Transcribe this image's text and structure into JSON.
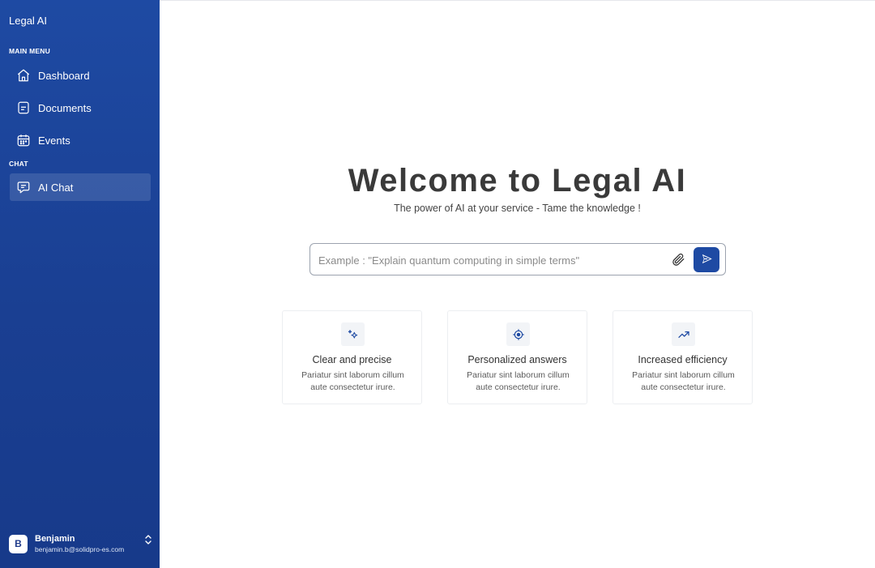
{
  "sidebar": {
    "brand": "Legal AI",
    "main_menu_label": "MAIN MENU",
    "main_menu_items": [
      {
        "label": "Dashboard",
        "icon": "home-icon"
      },
      {
        "label": "Documents",
        "icon": "document-icon"
      },
      {
        "label": "Events",
        "icon": "calendar-icon"
      }
    ],
    "chat_label": "CHAT",
    "chat_items": [
      {
        "label": "AI Chat",
        "icon": "chat-icon",
        "active": true
      }
    ],
    "user": {
      "initial": "B",
      "name": "Benjamin",
      "email": "benjamin.b@solidpro-es.com"
    }
  },
  "main": {
    "title": "Welcome to Legal AI",
    "subtitle": "The power of AI at your service - Tame the knowledge !",
    "search": {
      "placeholder": "Example : \"Explain quantum computing in simple terms\"",
      "value": ""
    },
    "cards": [
      {
        "icon": "sparkles-icon",
        "title": "Clear and precise",
        "desc": "Pariatur sint laborum cillum aute consectetur irure."
      },
      {
        "icon": "target-icon",
        "title": "Personalized answers",
        "desc": "Pariatur sint laborum cillum aute consectetur irure."
      },
      {
        "icon": "trending-up-icon",
        "title": "Increased efficiency",
        "desc": "Pariatur sint laborum cillum aute consectetur irure."
      }
    ]
  },
  "colors": {
    "sidebar_bg": "#1e4aa3",
    "accent": "#1e4aa3",
    "title_text": "#3a3a3a"
  }
}
